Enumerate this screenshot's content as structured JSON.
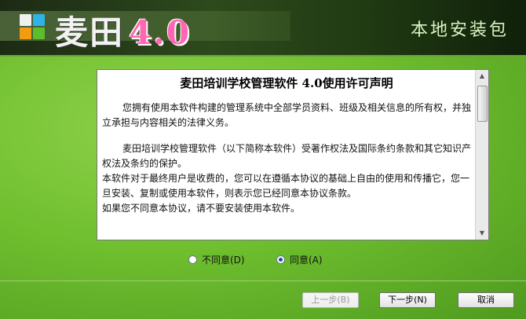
{
  "header": {
    "brand_name": "麦田",
    "brand_version": "4.0",
    "subtitle": "本地安装包",
    "logo_colors": [
      "#f0f0f0",
      "#2db3e6",
      "#f39c12",
      "#5bbf2b"
    ]
  },
  "license": {
    "title": "麦田培训学校管理软件 4.0使用许可声明",
    "paragraphs": [
      "您拥有使用本软件构建的管理系统中全部学员资料、班级及相关信息的所有权，并独立承担与内容相关的法律义务。",
      "麦田培训学校管理软件（以下简称本软件）受著作权法及国际条约条款和其它知识产权法及条约的保护。",
      "本软件对于最终用户是收费的，您可以在遵循本协议的基础上自由的使用和传播它，您一旦安装、复制或使用本软件，则表示您已经同意本协议条款。",
      "如果您不同意本协议，请不要安装使用本软件。"
    ]
  },
  "options": {
    "disagree_label": "不同意(D)",
    "agree_label": "同意(A)",
    "selected": "agree"
  },
  "buttons": {
    "back_label": "上一步(B)",
    "next_label": "下一步(N)",
    "cancel_label": "取消"
  }
}
